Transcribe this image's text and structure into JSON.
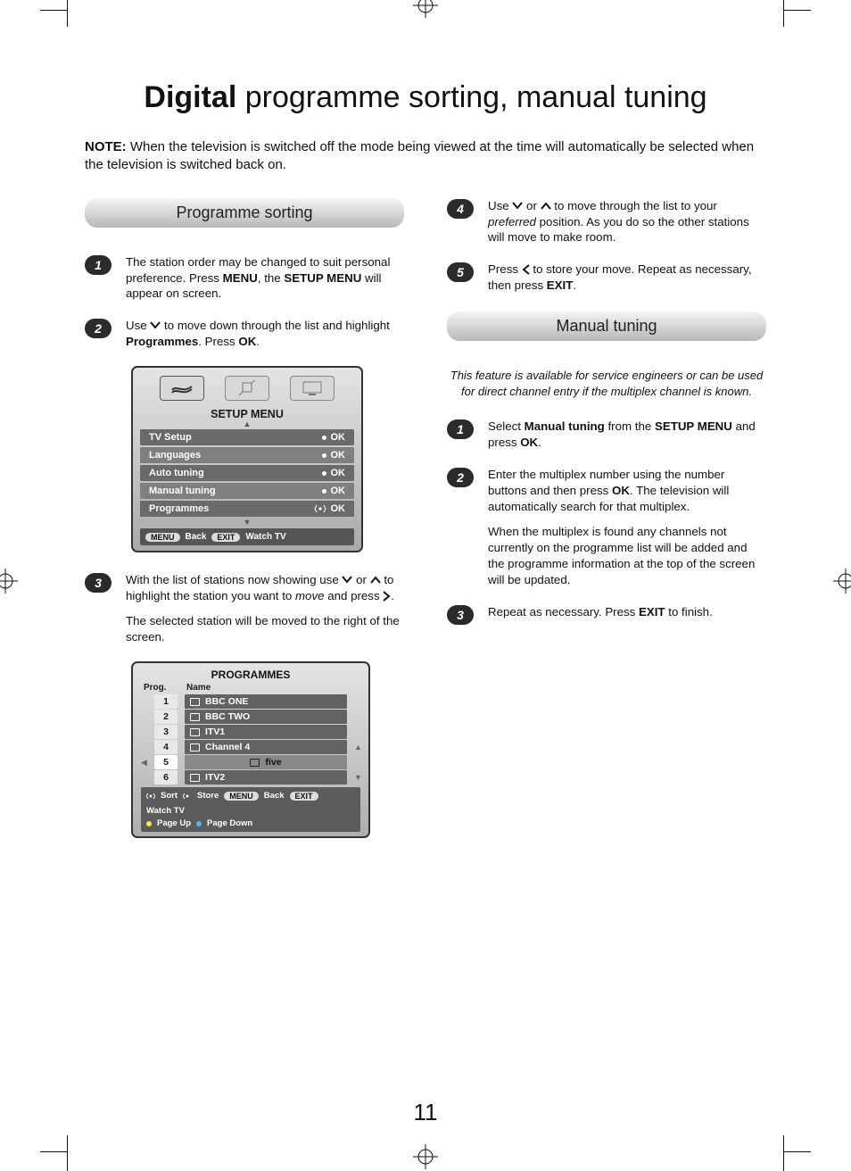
{
  "title": {
    "bold": "Digital",
    "rest": " programme sorting, manual tuning"
  },
  "note": {
    "label": "NOTE:",
    "text": " When the television is switched off the mode being viewed at the time will automatically be selected when the television is switched back on."
  },
  "section1": {
    "header": "Programme sorting",
    "steps": {
      "s1": {
        "n": "1",
        "html": "The station order may be changed to suit personal preference. Press <b>MENU</b>, the <b>SETUP MENU</b> will appear on screen."
      },
      "s2": {
        "n": "2",
        "pre": "Use ",
        "post": " to move down through the list and highlight <b>Programmes</b>. Press <b>OK</b>."
      },
      "s3": {
        "n": "3",
        "line1_pre": "With the list of stations now showing use ",
        "line1_mid": " or ",
        "line1_post": " to highlight the station you want to <i>move</i> and press ",
        "line1_end": ".",
        "line2": "The selected station will be moved to the right of the screen."
      }
    },
    "tvmenu": {
      "title": "SETUP MENU",
      "items": [
        {
          "label": "TV Setup",
          "right": "OK",
          "type": "dot"
        },
        {
          "label": "Languages",
          "right": "OK",
          "type": "dot"
        },
        {
          "label": "Auto tuning",
          "right": "OK",
          "type": "dot"
        },
        {
          "label": "Manual tuning",
          "right": "OK",
          "type": "dot"
        },
        {
          "label": "Programmes",
          "right": "OK",
          "type": "nav"
        }
      ],
      "footer": {
        "menu": "MENU",
        "back": "Back",
        "exit": "EXIT",
        "watch": "Watch TV"
      }
    },
    "prog": {
      "title": "PROGRAMMES",
      "cols": {
        "c1": "Prog.",
        "c2": "Name"
      },
      "rows": [
        {
          "n": "1",
          "name": "BBC ONE"
        },
        {
          "n": "2",
          "name": "BBC TWO"
        },
        {
          "n": "3",
          "name": "ITV1"
        },
        {
          "n": "4",
          "name": "Channel 4"
        },
        {
          "n": "5",
          "name": "five"
        },
        {
          "n": "6",
          "name": "ITV2"
        }
      ],
      "footer": {
        "sort": "Sort",
        "store": "Store",
        "menu": "MENU",
        "back": "Back",
        "exit": "EXIT",
        "watch": "Watch TV",
        "pup": "Page Up",
        "pdown": "Page Down"
      }
    }
  },
  "section2": {
    "steps": {
      "s4": {
        "n": "4",
        "pre": "Use ",
        "mid": " or ",
        "post": " to move through the list to your <i>preferred</i> position. As you do so the other stations will move to make room."
      },
      "s5": {
        "n": "5",
        "pre": "Press ",
        "post": " to store your move. Repeat as necessary, then press <b>EXIT</b>."
      }
    },
    "header": "Manual tuning",
    "intro": "This feature is available for service engineers or can be used for direct channel entry if the multiplex channel is known.",
    "mt": {
      "s1": {
        "n": "1",
        "html": "Select <b>Manual tuning</b> from the <b>SETUP MENU</b> and press <b>OK</b>."
      },
      "s2": {
        "n": "2",
        "p1": "Enter the multiplex number using the number buttons and then press <b>OK</b>. The television will automatically search for that multiplex.",
        "p2": "When the multiplex is found any channels not currently on the programme list will be added and the programme information at the top of the screen will be updated."
      },
      "s3": {
        "n": "3",
        "html": "Repeat as necessary. Press <b>EXIT</b> to finish."
      }
    }
  },
  "page_number": "11"
}
